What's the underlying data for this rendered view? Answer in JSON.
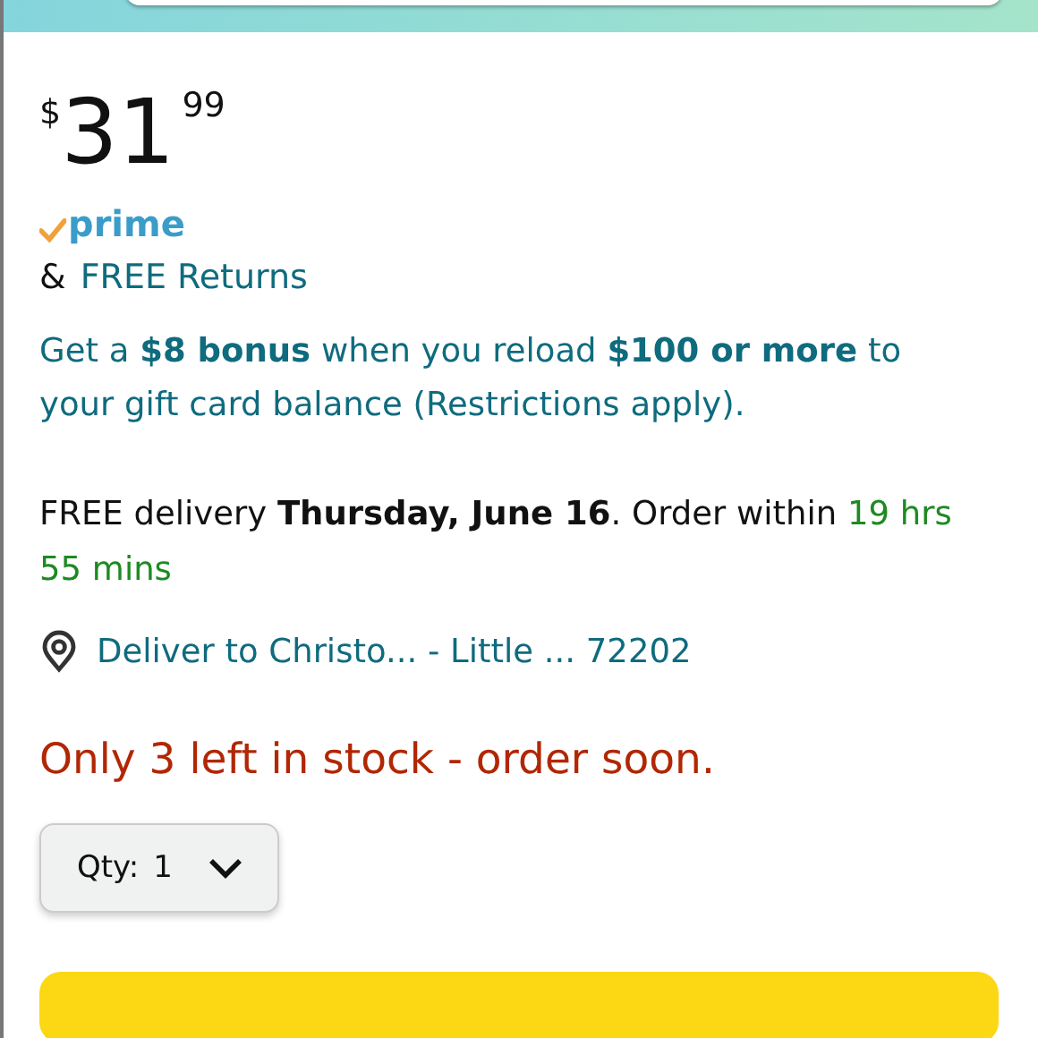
{
  "price": {
    "currency": "$",
    "whole": "31",
    "fraction": "99"
  },
  "prime": {
    "label": "prime"
  },
  "returns": {
    "prefix": "&",
    "link": "FREE Returns"
  },
  "promo": "Get a **$8 bonus** when you reload **$100 or more** to your gift card balance (Restrictions apply).",
  "delivery": {
    "text": "FREE delivery **Thursday, June 16**. Order within",
    "countdown": "19 hrs 55 mins"
  },
  "address": "Deliver to Christo... - Little ... 72202",
  "stock": "Only 3 left in stock - order soon.",
  "quantity": {
    "label": "Qty:",
    "value": "1"
  }
}
